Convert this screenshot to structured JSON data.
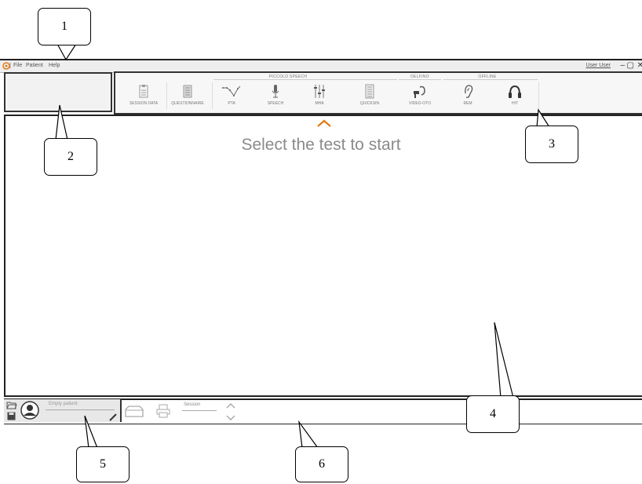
{
  "titlebar": {
    "menu": [
      "File",
      "Patient",
      "Help"
    ],
    "user": "User User",
    "minimize_glyph": "–",
    "maximize_glyph": "▢",
    "close_glyph": "✕"
  },
  "toolbar": {
    "groups": [
      {
        "label": "PICCOLO SPEECH"
      },
      {
        "label": "DELFINO"
      },
      {
        "label": "OFFLINE"
      }
    ],
    "tools": [
      {
        "label": "SESSION DATA",
        "icon": "clipboard-icon"
      },
      {
        "label": "QUESTIONNAIRE",
        "icon": "questionnaire-icon"
      },
      {
        "label": "PTA",
        "icon": "audiogram-icon"
      },
      {
        "label": "SPEECH",
        "icon": "microphone-icon"
      },
      {
        "label": "MHA",
        "icon": "sliders-icon"
      },
      {
        "label": "QUICKSIN",
        "icon": "list-icon"
      },
      {
        "label": "VIDEO-OTO",
        "icon": "otoscope-icon"
      },
      {
        "label": "REM",
        "icon": "ear-icon"
      },
      {
        "label": "HIT",
        "icon": "headphones-icon"
      }
    ]
  },
  "main": {
    "headline": "Select the test to start",
    "accent_color": "#e07b1a"
  },
  "status": {
    "patient": "Empty patient",
    "session": "Session"
  },
  "callouts": [
    "1",
    "2",
    "3",
    "4",
    "5",
    "6"
  ]
}
